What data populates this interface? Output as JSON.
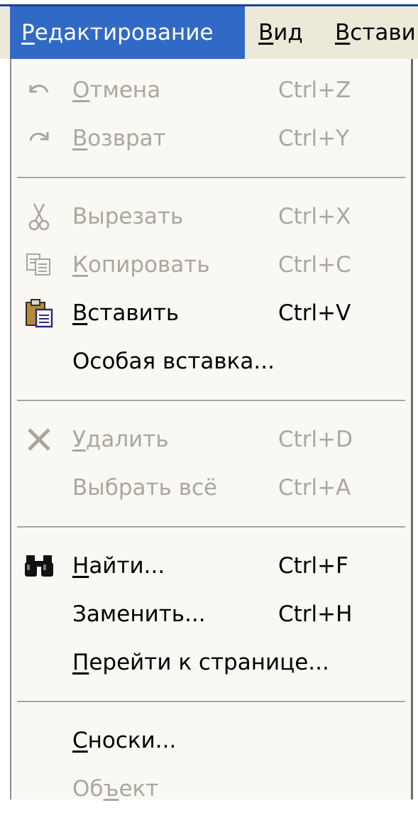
{
  "menubar": {
    "items": [
      {
        "label": "Редактирование",
        "accel_index": 0,
        "active": true
      },
      {
        "label": "Вид",
        "accel_index": 0,
        "active": false
      },
      {
        "label": "Встави",
        "accel_index": 0,
        "active": false
      }
    ]
  },
  "menu": {
    "groups": [
      [
        {
          "label": "Отмена",
          "shortcut": "Ctrl+Z",
          "enabled": false,
          "icon": "undo-icon",
          "accel_index": 0
        },
        {
          "label": "Возврат",
          "shortcut": "Ctrl+Y",
          "enabled": false,
          "icon": "redo-icon",
          "accel_index": 0
        }
      ],
      [
        {
          "label": "Вырезать",
          "shortcut": "Ctrl+X",
          "enabled": false,
          "icon": "scissors-icon",
          "accel_index": -1
        },
        {
          "label": "Копировать",
          "shortcut": "Ctrl+C",
          "enabled": false,
          "icon": "copy-icon",
          "accel_index": 0
        },
        {
          "label": "Вставить",
          "shortcut": "Ctrl+V",
          "enabled": true,
          "icon": "clipboard-icon",
          "accel_index": 0
        },
        {
          "label": "Особая вставка...",
          "shortcut": "",
          "enabled": true,
          "icon": "",
          "accel_index": -1
        }
      ],
      [
        {
          "label": "Удалить",
          "shortcut": "Ctrl+D",
          "enabled": false,
          "icon": "delete-x-icon",
          "accel_index": 0
        },
        {
          "label": "Выбрать всё",
          "shortcut": "Ctrl+A",
          "enabled": false,
          "icon": "",
          "accel_index": -1
        }
      ],
      [
        {
          "label": "Найти...",
          "shortcut": "Ctrl+F",
          "enabled": true,
          "icon": "binoculars-icon",
          "accel_index": 0
        },
        {
          "label": "Заменить...",
          "shortcut": "Ctrl+H",
          "enabled": true,
          "icon": "",
          "accel_index": -1
        },
        {
          "label": "Перейти к странице...",
          "shortcut": "",
          "enabled": true,
          "icon": "",
          "accel_index": 0
        }
      ],
      [
        {
          "label": "Сноски...",
          "shortcut": "",
          "enabled": true,
          "icon": "",
          "accel_index": 0
        },
        {
          "label": "Объект",
          "shortcut": "",
          "enabled": false,
          "icon": "",
          "accel_index": 2
        }
      ]
    ]
  }
}
